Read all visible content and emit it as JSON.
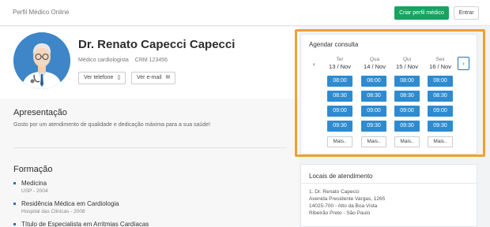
{
  "header": {
    "brand": "Perfil Médico Online",
    "create_label": "Criar perfil médico",
    "login_label": "Entrar",
    "colors": {
      "primary": "#1aa260"
    }
  },
  "doctor": {
    "name": "Dr. Renato Capecci Capecci",
    "specialty": "Médico cardiologista",
    "crm": "CRM 123456",
    "phone_label": "Ver telefone",
    "phone_icon": "phone-icon",
    "email_label": "Ver e-mail",
    "email_icon": "envelope-icon"
  },
  "presentation": {
    "title": "Apresentação",
    "text": "Gosto por um atendimento de qualidade e dedicação máxima para a sua saúde!"
  },
  "formation": {
    "title": "Formação",
    "items": [
      {
        "title": "Medicina",
        "sub": "USP - 2004"
      },
      {
        "title": "Residência Médica em Cardiologia",
        "sub": "Hospital das Clinicas - 2008"
      },
      {
        "title": "Título de Especialista em Arritmias Cardíacas",
        "sub": ""
      }
    ]
  },
  "schedule": {
    "title": "Agendar consulta",
    "prev": "‹",
    "next": "›",
    "days": [
      {
        "name": "Ter",
        "date": "13 / Nov",
        "slots": [
          "08:00",
          "08:30",
          "09:00",
          "09:30"
        ],
        "more": "Mais.."
      },
      {
        "name": "Qua",
        "date": "14 / Nov",
        "slots": [
          "08:00",
          "08:30",
          "09:00",
          "09:30"
        ],
        "more": "Mais.."
      },
      {
        "name": "Qui",
        "date": "15 / Nov",
        "slots": [
          "08:00",
          "08:30",
          "09:00",
          "09:30"
        ],
        "more": "Mais.."
      },
      {
        "name": "Sex",
        "date": "16 / Nov",
        "slots": [
          "08:00",
          "08:30",
          "09:00",
          "09:30"
        ],
        "more": "Mais.."
      }
    ],
    "colors": {
      "slot": "#2e8bd0",
      "highlight": "#f0a030"
    }
  },
  "locations": {
    "title": "Locais de atendimento",
    "lines": [
      "1. Dr. Renato Capecci",
      "Avenida Presidente Vargas, 1265",
      "14025-700 - Alto da Boa Vista",
      "Ribeirão Preto - São Paulo"
    ]
  }
}
